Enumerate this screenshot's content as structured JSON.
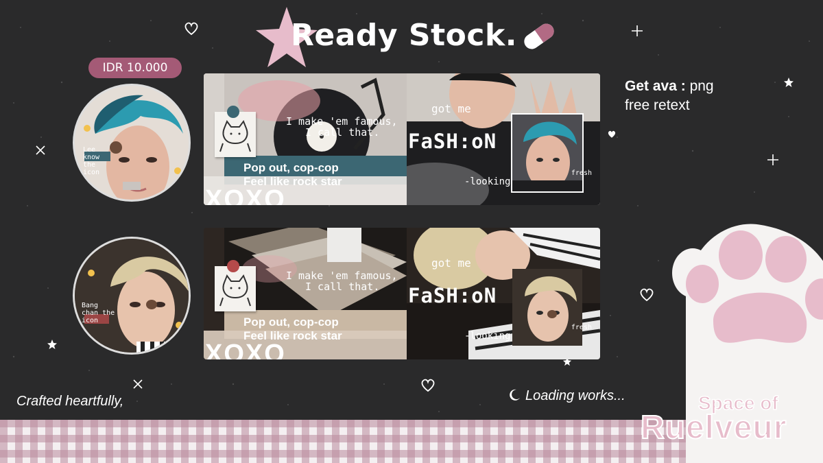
{
  "header": {
    "title": "Ready Stock.",
    "star_icon": "star-icon",
    "pill_icon": "pill-icon"
  },
  "price": {
    "label": "IDR 10.000"
  },
  "info": {
    "get_ava_label": "Get ava :",
    "get_ava_value": "png",
    "retext": "free retext"
  },
  "avatars": [
    {
      "caption": "Lee know the icon"
    },
    {
      "caption": "Bang chan the icon"
    }
  ],
  "banners": [
    {
      "handwritten": [
        "I make 'em famous,",
        "I call that."
      ],
      "pop_line_1": "Pop out, cop-cop",
      "pop_line_2": "Feel like rock star",
      "xoxo": "XOXO",
      "got_me": "got me",
      "fashion": "FaSH:oN",
      "looking": "-looking",
      "fresh": "fresh",
      "accent_band": "#3c6773"
    },
    {
      "handwritten": [
        "I make 'em famous,",
        "I call that."
      ],
      "pop_line_1": "Pop out, cop-cop",
      "pop_line_2": "Feel like rock star",
      "xoxo": "XOXO",
      "got_me": "got me",
      "fashion": "FaSH:oN",
      "looking": "-looking",
      "fresh": "fresh",
      "accent_band": "#c9b8a4"
    }
  ],
  "footer": {
    "crafted": "Crafted heartfully,",
    "loading": "Loading works...",
    "brand_top": "Space of",
    "brand_bottom": "Ruelveur"
  },
  "colors": {
    "background": "#2a2a2b",
    "accent_pink": "#a45a76",
    "paw_pink": "#e7bccb",
    "gingham": "#b98a9c"
  }
}
